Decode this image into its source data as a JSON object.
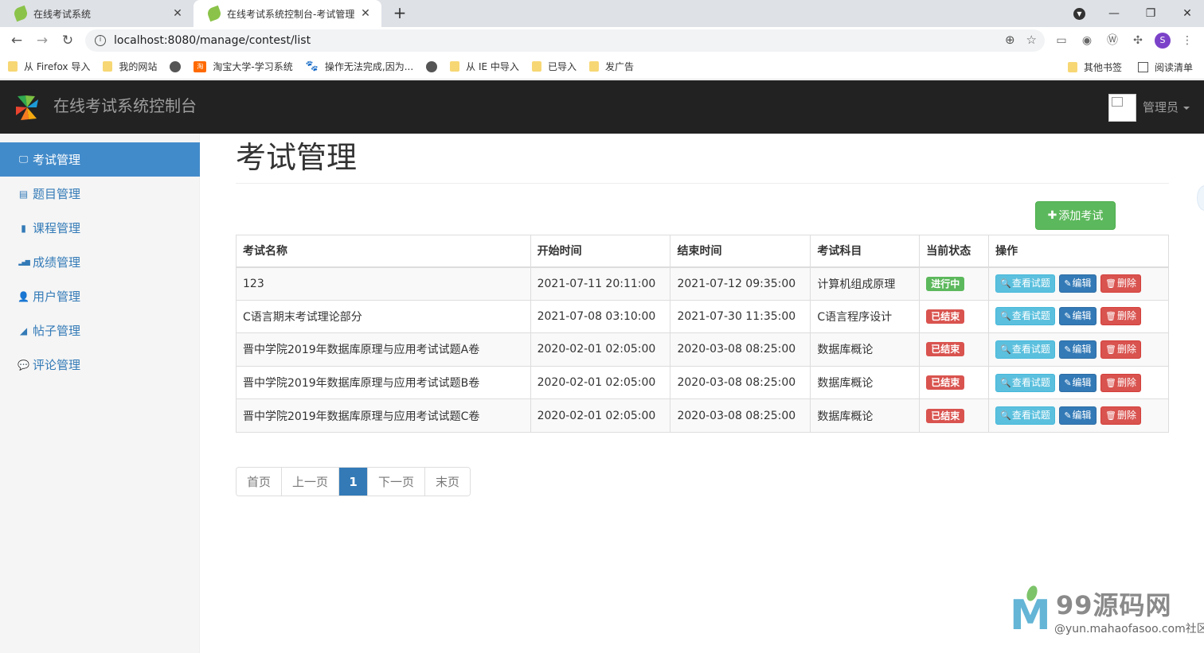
{
  "browser": {
    "tabs": [
      {
        "title": "在线考试系统",
        "active": false
      },
      {
        "title": "在线考试系统控制台-考试管理",
        "active": true
      }
    ],
    "url": "localhost:8080/manage/contest/list",
    "profile_initial": "S",
    "bookmarks": [
      "从 Firefox 导入",
      "我的网站",
      "淘宝大学-学习系统",
      "操作无法完成,因为...",
      "从 IE 中导入",
      "已导入",
      "发广告"
    ],
    "bookmarks_right": [
      "其他书签",
      "阅读清单"
    ],
    "taobao_badge": "淘"
  },
  "navbar": {
    "brand": "在线考试系统控制台",
    "user": "管理员"
  },
  "sidebar": {
    "items": [
      {
        "label": "考试管理",
        "icon": "monitor-icon",
        "glyph": "🖵",
        "active": true
      },
      {
        "label": "题目管理",
        "icon": "list-alt-icon",
        "glyph": "▤",
        "active": false
      },
      {
        "label": "课程管理",
        "icon": "book-icon",
        "glyph": "▮",
        "active": false
      },
      {
        "label": "成绩管理",
        "icon": "signal-icon",
        "glyph": "▂▄▆",
        "active": false
      },
      {
        "label": "用户管理",
        "icon": "user-icon",
        "glyph": "👤",
        "active": false
      },
      {
        "label": "帖子管理",
        "icon": "send-icon",
        "glyph": "◢",
        "active": false
      },
      {
        "label": "评论管理",
        "icon": "comment-icon",
        "glyph": "💬",
        "active": false
      }
    ]
  },
  "main": {
    "title": "考试管理",
    "add_button": "添加考试",
    "table": {
      "headers": [
        "考试名称",
        "开始时间",
        "结束时间",
        "考试科目",
        "当前状态",
        "操作"
      ],
      "rows": [
        {
          "name": "123",
          "start": "2021-07-11 20:11:00",
          "end": "2021-07-12 09:35:00",
          "subject": "计算机组成原理",
          "status": "进行中",
          "status_type": "ongoing"
        },
        {
          "name": "C语言期末考试理论部分",
          "start": "2021-07-08 03:10:00",
          "end": "2021-07-30 11:35:00",
          "subject": "C语言程序设计",
          "status": "已结束",
          "status_type": "ended"
        },
        {
          "name": "晋中学院2019年数据库原理与应用考试试题A卷",
          "start": "2020-02-01 02:05:00",
          "end": "2020-03-08 08:25:00",
          "subject": "数据库概论",
          "status": "已结束",
          "status_type": "ended"
        },
        {
          "name": "晋中学院2019年数据库原理与应用考试试题B卷",
          "start": "2020-02-01 02:05:00",
          "end": "2020-03-08 08:25:00",
          "subject": "数据库概论",
          "status": "已结束",
          "status_type": "ended"
        },
        {
          "name": "晋中学院2019年数据库原理与应用考试试题C卷",
          "start": "2020-02-01 02:05:00",
          "end": "2020-03-08 08:25:00",
          "subject": "数据库概论",
          "status": "已结束",
          "status_type": "ended"
        }
      ],
      "actions": {
        "view": "查看试题",
        "edit": "编辑",
        "delete": "删除"
      }
    },
    "pagination": {
      "first": "首页",
      "prev": "上一页",
      "current": "1",
      "next": "下一页",
      "last": "末页"
    }
  },
  "watermark": {
    "title": "99源码网",
    "subtitle": "@yun.mahaofasoo.com社区"
  }
}
